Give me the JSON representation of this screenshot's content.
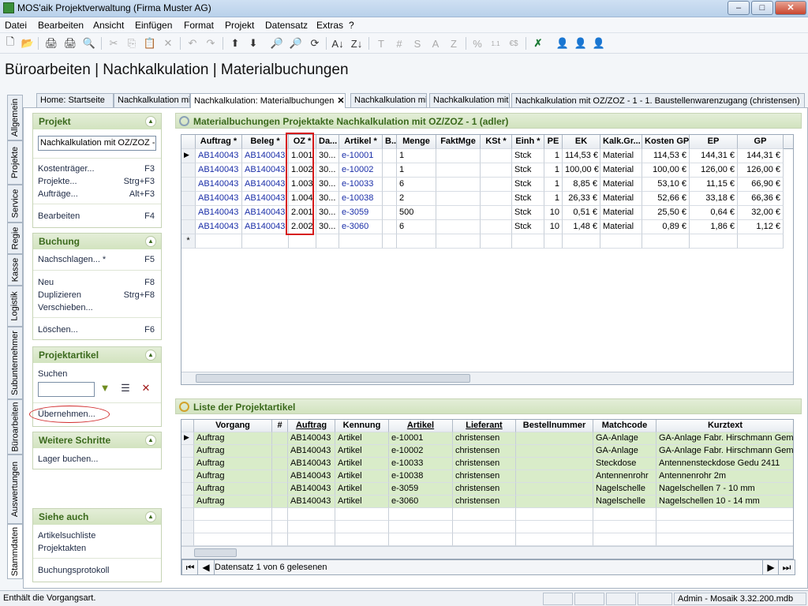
{
  "window": {
    "title": "MOS'aik Projektverwaltung (Firma Muster AG)",
    "min": "–",
    "max": "□",
    "close": "✕"
  },
  "menu": [
    "Datei",
    "Bearbeiten",
    "Ansicht",
    "Einfügen",
    "Format",
    "Projekt",
    "Datensatz",
    "Extras",
    "?"
  ],
  "toolbar_glyphs": {
    "new": "🗋",
    "open": "📂",
    "print": "🖨",
    "preview": "🔍",
    "cut": "✂",
    "copy": "⎘",
    "paste": "📋",
    "delete": "✕",
    "undo": "↶",
    "redo": "↷",
    "up": "⬆",
    "down": "⬇",
    "find": "🔎",
    "refresh": "⟳",
    "sort_az": "A↓",
    "sort_za": "Z↓",
    "t": "T",
    "hash": "#",
    "s": "S",
    "a": "A",
    "z": "Z",
    "percent": "%",
    "dec": "1.1",
    "euro": "€$",
    "excel": "✗",
    "user1": "👤",
    "user2": "👤",
    "user3": "👤"
  },
  "page_title": "Büroarbeiten | Nachkalkulation | Materialbuchungen",
  "doc_tabs": [
    "Home: Startseite",
    "Nachkalkulation mi",
    "Nachkalkulation: Materialbuchungen",
    "Nachkalkulation mit",
    "Nachkalkulation mit",
    "Nachkalkulation mit OZ/ZOZ - 1 - 1. Baustellenwarenzugang (christensen)"
  ],
  "tab_close": "✕",
  "side_tabs": [
    "Allgemein",
    "Projekte",
    "Service",
    "Regie",
    "Kasse",
    "Logistik",
    "Subunternehmer",
    "Büroarbeiten",
    "Auswertungen",
    "Stammdaten"
  ],
  "left": {
    "projekt": {
      "title": "Projekt",
      "field": "Nachkalkulation mit OZ/ZOZ -",
      "items": [
        {
          "label": "Kostenträger...",
          "key": "F3"
        },
        {
          "label": "Projekte...",
          "key": "Strg+F3"
        },
        {
          "label": "Aufträge...",
          "key": "Alt+F3"
        },
        {
          "label": "Bearbeiten",
          "key": "F4"
        }
      ]
    },
    "buchung": {
      "title": "Buchung",
      "items": [
        {
          "label": "Nachschlagen... *",
          "key": "F5"
        },
        {
          "label": "Neu",
          "key": "F8"
        },
        {
          "label": "Duplizieren",
          "key": "Strg+F8"
        },
        {
          "label": "Verschieben...",
          "key": ""
        },
        {
          "label": "Löschen...",
          "key": "F6"
        }
      ]
    },
    "projektartikel": {
      "title": "Projektartikel",
      "search_label": "Suchen",
      "search_value": "",
      "uebernehmen": "Übernehmen..."
    },
    "weitere": {
      "title": "Weitere Schritte",
      "items": [
        "Lager buchen..."
      ]
    },
    "siehe": {
      "title": "Siehe auch",
      "items": [
        "Artikelsuchliste",
        "Projektakten",
        "Buchungsprotokoll"
      ]
    },
    "chevron": "▲"
  },
  "grid1": {
    "title": "Materialbuchungen Projektakte Nachkalkulation mit OZ/ZOZ - 1 (adler)",
    "headers": [
      "",
      "Auftrag *",
      "Beleg *",
      "OZ *",
      "Da...",
      "Artikel *",
      "B...",
      "Menge",
      "FaktMge",
      "KSt *",
      "Einh *",
      "PE",
      "EK",
      "Kalk.Gr...",
      "Kosten GP",
      "EP",
      "GP"
    ],
    "rows": [
      [
        "AB140043",
        "AB140043",
        "1.001",
        "30...",
        "e-10001",
        "",
        "1",
        "",
        "",
        "Stck",
        "1",
        "114,53 €",
        "Material",
        "114,53 €",
        "144,31 €",
        "144,31 €"
      ],
      [
        "AB140043",
        "AB140043",
        "1.002",
        "30...",
        "e-10002",
        "",
        "1",
        "",
        "",
        "Stck",
        "1",
        "100,00 €",
        "Material",
        "100,00 €",
        "126,00 €",
        "126,00 €"
      ],
      [
        "AB140043",
        "AB140043",
        "1.003",
        "30...",
        "e-10033",
        "",
        "6",
        "",
        "",
        "Stck",
        "1",
        "8,85 €",
        "Material",
        "53,10 €",
        "11,15 €",
        "66,90 €"
      ],
      [
        "AB140043",
        "AB140043",
        "1.004",
        "30...",
        "e-10038",
        "",
        "2",
        "",
        "",
        "Stck",
        "1",
        "26,33 €",
        "Material",
        "52,66 €",
        "33,18 €",
        "66,36 €"
      ],
      [
        "AB140043",
        "AB140043",
        "2.001",
        "30...",
        "e-3059",
        "",
        "500",
        "",
        "",
        "Stck",
        "10",
        "0,51 €",
        "Material",
        "25,50 €",
        "0,64 €",
        "32,00 €"
      ],
      [
        "AB140043",
        "AB140043",
        "2.002",
        "30...",
        "e-3060",
        "",
        "6",
        "",
        "",
        "Stck",
        "10",
        "1,48 €",
        "Material",
        "0,89 €",
        "1,86 €",
        "1,12 €"
      ]
    ],
    "new_row_marker": "*",
    "row_marker": "▶"
  },
  "grid2": {
    "title": "Liste der Projektartikel",
    "headers": [
      "",
      "Vorgang",
      "#",
      "Auftrag",
      "Kennung",
      "Artikel",
      "Lieferant",
      "Bestellnummer",
      "Matchcode",
      "Kurztext"
    ],
    "rows": [
      [
        "Auftrag",
        "",
        "AB140043",
        "Artikel",
        "e-10001",
        "christensen",
        "",
        "GA-Anlage",
        "GA-Anlage Fabr. Hirschmann Gema"
      ],
      [
        "Auftrag",
        "",
        "AB140043",
        "Artikel",
        "e-10002",
        "christensen",
        "",
        "GA-Anlage",
        "GA-Anlage Fabr. Hirschmann Gema"
      ],
      [
        "Auftrag",
        "",
        "AB140043",
        "Artikel",
        "e-10033",
        "christensen",
        "",
        "Steckdose",
        "Antennensteckdose Gedu 2411"
      ],
      [
        "Auftrag",
        "",
        "AB140043",
        "Artikel",
        "e-10038",
        "christensen",
        "",
        "Antennenrohr",
        "Antennenrohr 2m"
      ],
      [
        "Auftrag",
        "",
        "AB140043",
        "Artikel",
        "e-3059",
        "christensen",
        "",
        "Nagelschelle",
        "Nagelschellen 7 - 10 mm"
      ],
      [
        "Auftrag",
        "",
        "AB140043",
        "Artikel",
        "e-3060",
        "christensen",
        "",
        "Nagelschelle",
        "Nagelschellen 10 - 14 mm"
      ]
    ],
    "nav": {
      "first": "⏮",
      "prev": "◀",
      "next": "▶",
      "last": "⏭",
      "text": "Datensatz 1 von 6 gelesenen"
    }
  },
  "status": {
    "left": "Enthält die Vorgangsart.",
    "right": "Admin - Mosaik 3.32.200.mdb"
  }
}
